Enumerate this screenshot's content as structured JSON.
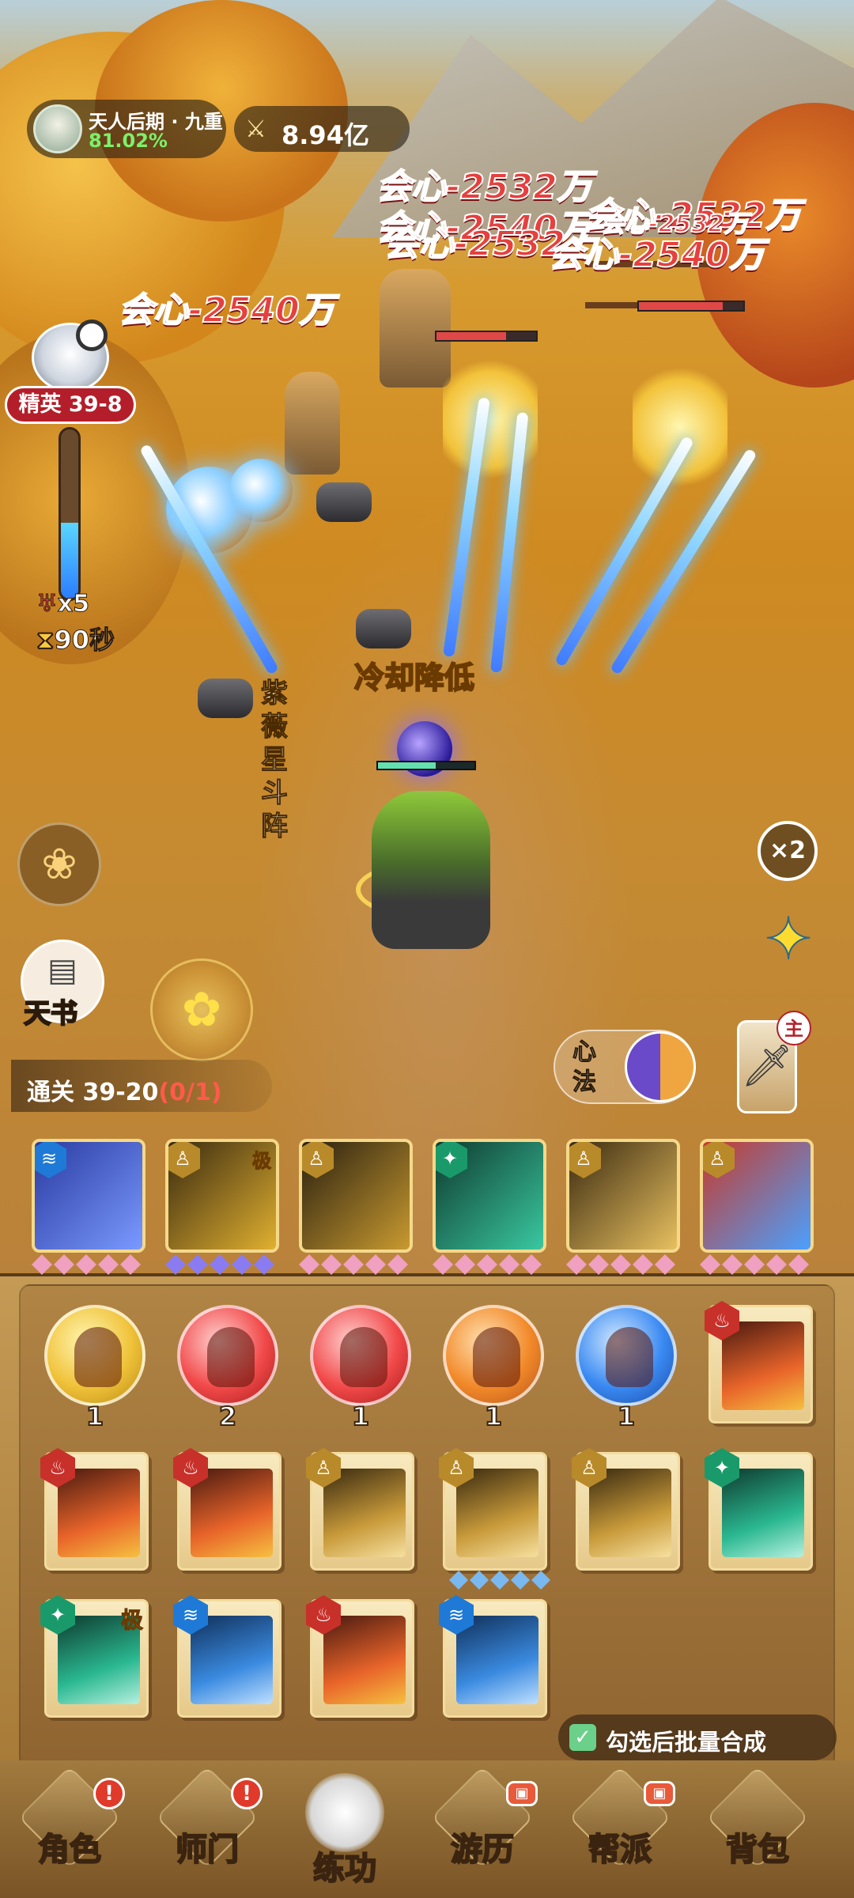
{
  "player": {
    "realm": "天人后期 · 九重",
    "realm_progress": "81.02%",
    "power_icon": "crossed-swords-icon",
    "power": "8.94亿"
  },
  "stage": {
    "name": "精英 39-8",
    "progress_fraction": 0.45,
    "lives": "x5",
    "timer": "90秒"
  },
  "floating_text": {
    "crit_hits": [
      "会心-2532万",
      "会心-2540万",
      "会心-2532万",
      "会心-2532万",
      "会心-2540万",
      "会心-2540万",
      "会心-2532万"
    ],
    "cooldown": "冷却降低",
    "formation": "紫薇星斗阵"
  },
  "side_buttons": {
    "book_label": "天书",
    "speed": "×2",
    "xinfa_label": "心法",
    "weapon_tag": "主"
  },
  "clear": {
    "label": "通关 39-20",
    "count": "(0/1)"
  },
  "equipped_skills": [
    {
      "element": "water",
      "element_glyph": "≋",
      "ji": "",
      "colors": [
        "#2a3aa0",
        "#7a9aff"
      ],
      "star_color": "#f0a0c0"
    },
    {
      "element": "metal",
      "element_glyph": "♙",
      "ji": "极",
      "colors": [
        "#3a2a10",
        "#e0b030"
      ],
      "star_color": "#8a7cf0"
    },
    {
      "element": "metal",
      "element_glyph": "♙",
      "ji": "",
      "colors": [
        "#2a2010",
        "#c89a30"
      ],
      "star_color": "#f0a0c0"
    },
    {
      "element": "wood",
      "element_glyph": "✦",
      "ji": "",
      "colors": [
        "#0e3a2e",
        "#3ac8a0"
      ],
      "star_color": "#f0a0c0"
    },
    {
      "element": "metal",
      "element_glyph": "♙",
      "ji": "",
      "colors": [
        "#3a2a10",
        "#e8c060"
      ],
      "star_color": "#f0a0c0"
    },
    {
      "element": "metal",
      "element_glyph": "♙",
      "ji": "",
      "colors": [
        "#c83a2a",
        "#4aa0ff"
      ],
      "star_color": "#f0a0c0"
    }
  ],
  "inventory": {
    "balls": [
      {
        "color": "yellow",
        "count": "1"
      },
      {
        "color": "red",
        "count": "2"
      },
      {
        "color": "red",
        "count": "1"
      },
      {
        "color": "orange",
        "count": "1"
      },
      {
        "color": "blue",
        "count": "1"
      }
    ],
    "scrolls": [
      {
        "element": "fire",
        "ji": "",
        "stars": 0
      },
      {
        "element": "fire",
        "ji": "",
        "stars": 0
      },
      {
        "element": "fire",
        "ji": "",
        "stars": 0
      },
      {
        "element": "metal",
        "ji": "",
        "stars": 0
      },
      {
        "element": "metal",
        "ji": "",
        "stars": 5
      },
      {
        "element": "metal",
        "ji": "",
        "stars": 0
      },
      {
        "element": "wood",
        "ji": "",
        "stars": 0
      },
      {
        "element": "wood",
        "ji": "极",
        "stars": 0
      },
      {
        "element": "water",
        "ji": "",
        "stars": 0
      },
      {
        "element": "fire",
        "ji": "",
        "stars": 0
      },
      {
        "element": "water",
        "ji": "",
        "stars": 0
      }
    ],
    "batch_label": "勾选后批量合成"
  },
  "nav": [
    {
      "label": "角色",
      "badge": "!",
      "badge_type": "alert"
    },
    {
      "label": "师门",
      "badge": "!",
      "badge_type": "alert"
    },
    {
      "label": "练功",
      "badge": "",
      "badge_type": "active"
    },
    {
      "label": "游历",
      "badge": "▣",
      "badge_type": "video"
    },
    {
      "label": "帮派",
      "badge": "▣",
      "badge_type": "video"
    },
    {
      "label": "背包",
      "badge": "",
      "badge_type": "none"
    }
  ],
  "colors": {
    "crit": "#e6403e",
    "stage_badge": "#b41e2a",
    "realm_progress": "#7cf06a",
    "cooldown": "#ffe45c"
  }
}
